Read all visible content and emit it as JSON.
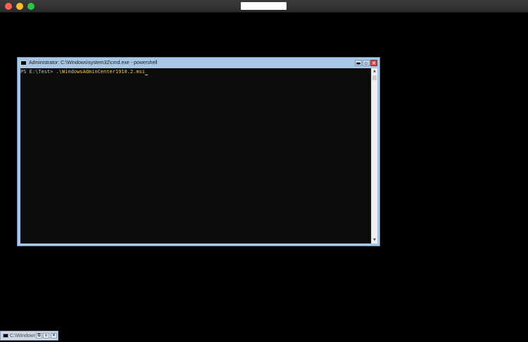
{
  "host_window": {
    "title": ""
  },
  "console_window": {
    "title": "Administrator: C:\\Windows\\system32\\cmd.exe - powershell",
    "icon": "console-icon",
    "controls": {
      "minimize_icon": "minimize-icon",
      "maximize_icon": "maximize-icon",
      "close_icon": "close-icon",
      "minimize_glyph": "▬",
      "maximize_glyph": "▫",
      "close_glyph": "✕"
    },
    "prompt": "PS E:\\Test> ",
    "command": ".\\WindowsAdminCenter1910.2.msi",
    "colors": {
      "frame": "#a9c8e8",
      "console_bg": "#0c0c0c",
      "prompt_text": "#c0c0c0",
      "command_text": "#e8c85a",
      "close_button": "#c75050"
    },
    "scrollbar": {
      "up_glyph": "▲",
      "down_glyph": "▼"
    }
  },
  "taskbar": {
    "item_label": "C:\\Windows\\",
    "restore_glyph": "⧉",
    "maximize_glyph": "▫",
    "close_glyph": "✕"
  }
}
